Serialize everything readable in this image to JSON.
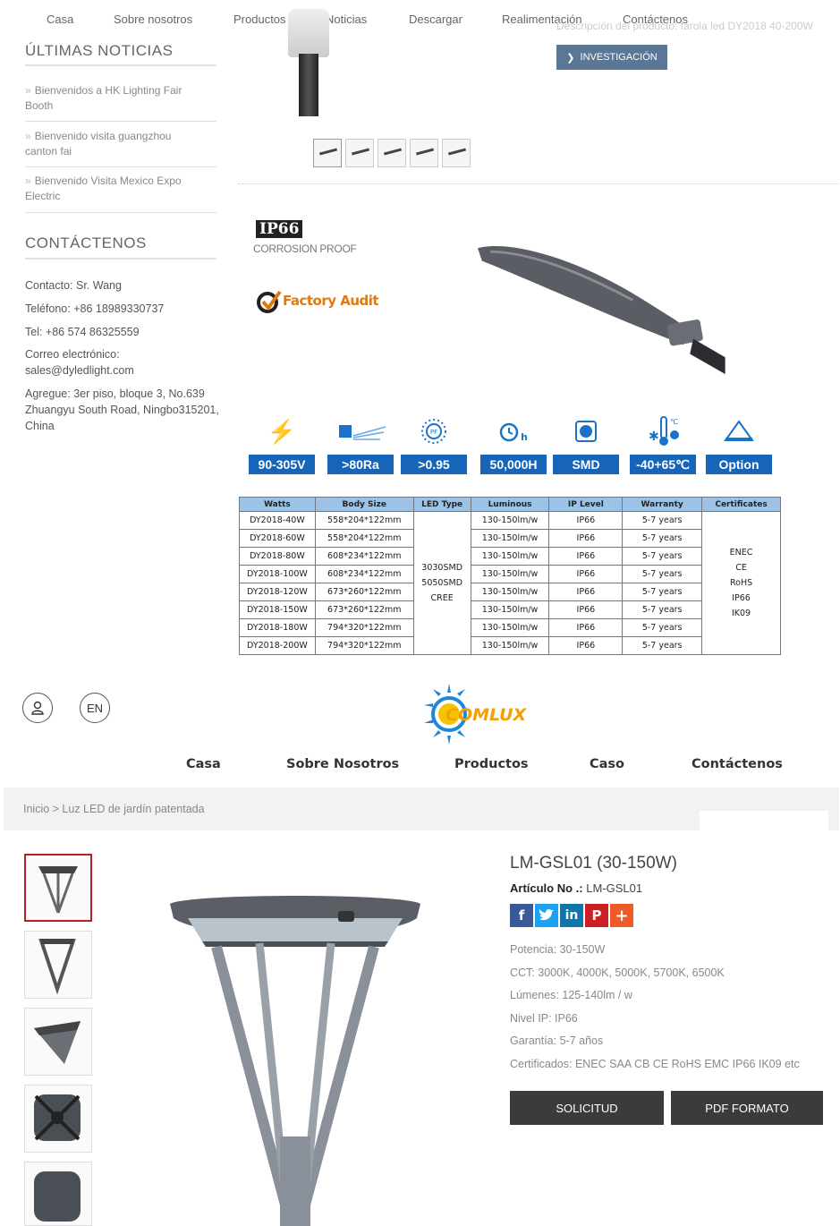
{
  "top_nav": [
    "Casa",
    "Sobre nosotros",
    "Productos",
    "Noticias",
    "Descargar",
    "Realimentación",
    "Contáctenos"
  ],
  "faded_description": "Descripción del producto: farola led DY2018 40-200W",
  "investigate_button": "INVESTIGACIÓN",
  "sidebar": {
    "news_title": "ÚLTIMAS NOTICIAS",
    "news": [
      "Bienvenidos a HK Lighting Fair Booth",
      "Bienvenido visita guangzhou canton fai",
      "Bienvenido Visita Mexico Expo Electric"
    ],
    "contact_title": "CONTÁCTENOS",
    "contact": {
      "person": "Contacto: Sr. Wang",
      "phone": "Teléfono: +86 18989330737",
      "tel": "Tel: +86 574 86325559",
      "email_label": "Correo electrónico:",
      "email": "sales@dyledlight.com",
      "address": "Agregue: 3er piso, bloque 3, No.639 Zhuangyu South Road, Ningbo315201, China"
    }
  },
  "badges": {
    "ip": "IP66",
    "corrosion": "CORROSION PROOF",
    "factory_audit": "Factory Audit"
  },
  "features": [
    {
      "icon": "lightning-icon",
      "value": "90-305V"
    },
    {
      "icon": "light-beam-icon",
      "value": ">80Ra"
    },
    {
      "icon": "power-factor-icon",
      "value": ">0.95"
    },
    {
      "icon": "clock-hours-icon",
      "value": "50,000H"
    },
    {
      "icon": "smd-chip-icon",
      "value": "SMD"
    },
    {
      "icon": "thermometer-icon",
      "value": "-40+65℃"
    },
    {
      "icon": "optics-triangle-icon",
      "value": "Option"
    }
  ],
  "spec_table": {
    "headers": [
      "Watts",
      "Body Size",
      "LED Type",
      "Luminous",
      "IP Level",
      "Warranty",
      "Certificates"
    ],
    "rows": [
      [
        "DY2018-40W",
        "558*204*122mm",
        "130-150lm/w",
        "IP66",
        "5-7 years"
      ],
      [
        "DY2018-60W",
        "558*204*122mm",
        "130-150lm/w",
        "IP66",
        "5-7 years"
      ],
      [
        "DY2018-80W",
        "608*234*122mm",
        "130-150lm/w",
        "IP66",
        "5-7 years"
      ],
      [
        "DY2018-100W",
        "608*234*122mm",
        "130-150lm/w",
        "IP66",
        "5-7 years"
      ],
      [
        "DY2018-120W",
        "673*260*122mm",
        "130-150lm/w",
        "IP66",
        "5-7 years"
      ],
      [
        "DY2018-150W",
        "673*260*122mm",
        "130-150lm/w",
        "IP66",
        "5-7 years"
      ],
      [
        "DY2018-180W",
        "794*320*122mm",
        "130-150lm/w",
        "IP66",
        "5-7 years"
      ],
      [
        "DY2018-200W",
        "794*320*122mm",
        "130-150lm/w",
        "IP66",
        "5-7 years"
      ]
    ],
    "led_type": [
      "3030SMD",
      "5050SMD",
      "CREE"
    ],
    "certificates": [
      "ENEC",
      "CE",
      "RoHS",
      "IP66",
      "IK09"
    ]
  },
  "site2": {
    "lang": "EN",
    "logo_text": "COMLUX",
    "nav": [
      "Casa",
      "Sobre Nosotros",
      "Productos",
      "Caso",
      "Contáctenos"
    ],
    "breadcrumb": "Inicio > Luz LED de jardín patentada"
  },
  "product": {
    "title": "LM-GSL01 (30-150W)",
    "article_label": "Artículo No .:",
    "article_value": "LM-GSL01",
    "specs": [
      "Potencia: 30-150W",
      "CCT: 3000K, 4000K, 5000K, 5700K, 6500K",
      "Lúmenes: 125-140lm / w",
      "Nivel IP: IP66",
      "Garantía: 5-7 años",
      "Certificados: ENEC SAA CB CE RoHS EMC IP66 IK09 etc"
    ],
    "request_button": "SOLICITUD",
    "pdf_button": "PDF FORMATO"
  },
  "colors": {
    "accent_blue": "#1665b8",
    "table_header": "#9cc3e6",
    "dark_button": "#3b3b3b",
    "factory_orange": "#e07a10"
  }
}
